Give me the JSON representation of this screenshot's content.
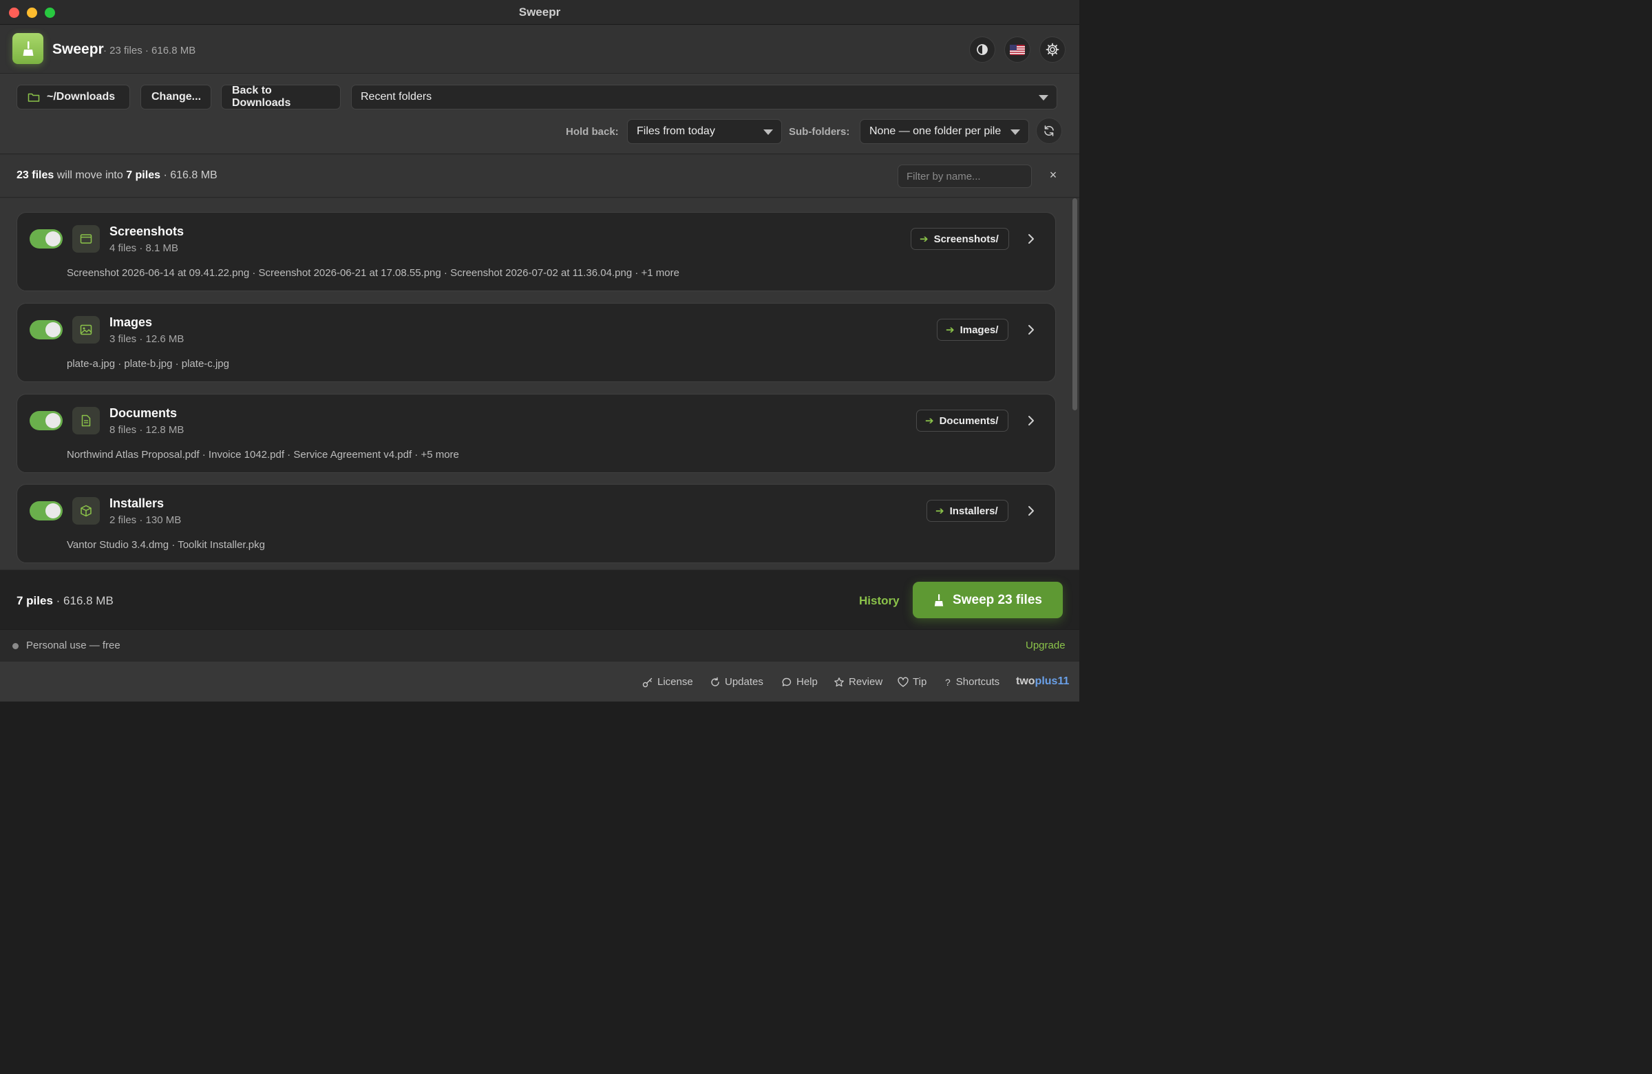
{
  "window": {
    "title": "Sweepr"
  },
  "header": {
    "app_name": "Sweepr",
    "meta": "· 23 files · 616.8 MB",
    "buttons": [
      "contrast-icon",
      "flag-icon",
      "gear-icon"
    ]
  },
  "toolbar": {
    "folder_label": "~/Downloads",
    "change_label": "Change...",
    "back_label": "Back to Downloads",
    "recent_placeholder": "Recent folders",
    "hold_back_label": "Hold back:",
    "hold_back_value": "Files from today",
    "subfolders_label": "Sub-folders:",
    "subfolders_value": "None — one folder per pile"
  },
  "summary": {
    "files_count": "23 files",
    "middle": " will move into ",
    "piles_count": "7 piles",
    "size": " · 616.8 MB",
    "filter_placeholder": "Filter by name...",
    "clear": "×"
  },
  "piles": [
    {
      "name": "Screenshots",
      "meta": "4 files · 8.1 MB",
      "files": "Screenshot 2026-06-14 at 09.41.22.png · Screenshot 2026-06-21 at 17.08.55.png · Screenshot 2026-07-02 at 11.36.04.png · +1 more",
      "dest": "Screenshots/",
      "icon": "window-icon",
      "enabled": true
    },
    {
      "name": "Images",
      "meta": "3 files · 12.6 MB",
      "files": "plate-a.jpg · plate-b.jpg · plate-c.jpg",
      "dest": "Images/",
      "icon": "image-icon",
      "enabled": true
    },
    {
      "name": "Documents",
      "meta": "8 files · 12.8 MB",
      "files": "Northwind Atlas Proposal.pdf · Invoice 1042.pdf · Service Agreement v4.pdf · +5 more",
      "dest": "Documents/",
      "icon": "document-icon",
      "enabled": true
    },
    {
      "name": "Installers",
      "meta": "2 files · 130 MB",
      "files": "Vantor Studio 3.4.dmg · Toolkit Installer.pkg",
      "dest": "Installers/",
      "icon": "box-icon",
      "enabled": true
    }
  ],
  "footer": {
    "piles": "7 piles",
    "size": " · 616.8 MB",
    "history_label": "History",
    "sweep_label": "Sweep 23 files"
  },
  "status": {
    "license_text": "Personal use — free",
    "upgrade_label": "Upgrade"
  },
  "links": {
    "license": "License",
    "updates": "Updates",
    "help": "Help",
    "review": "Review",
    "tip": "Tip",
    "shortcuts": "Shortcuts",
    "brand_a": "two",
    "brand_b": "plus11"
  },
  "colors": {
    "accent": "#8bc34a",
    "toggle_on": "#6ab04c",
    "sweep_button": "#5e9933",
    "brand_blue": "#6aa0e8"
  }
}
